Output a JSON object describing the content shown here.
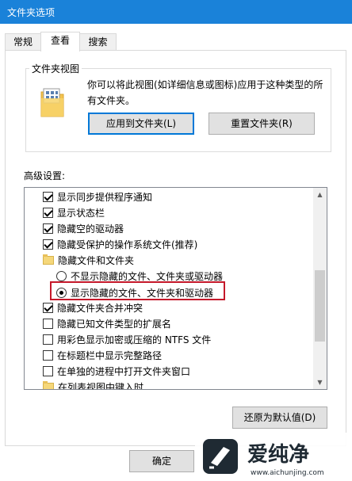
{
  "window": {
    "title": "文件夹选项"
  },
  "tabs": [
    {
      "label": "常规"
    },
    {
      "label": "查看"
    },
    {
      "label": "搜索"
    }
  ],
  "folder_views": {
    "legend": "文件夹视图",
    "description": "你可以将此视图(如详细信息或图标)应用于这种类型的所有文件夹。",
    "apply_label": "应用到文件夹(L)",
    "reset_label": "重置文件夹(R)"
  },
  "advanced": {
    "label": "高级设置:",
    "items": [
      {
        "type": "checkbox",
        "checked": true,
        "label": "显示同步提供程序通知"
      },
      {
        "type": "checkbox",
        "checked": true,
        "label": "显示状态栏"
      },
      {
        "type": "checkbox",
        "checked": true,
        "label": "隐藏空的驱动器"
      },
      {
        "type": "checkbox",
        "checked": true,
        "label": "隐藏受保护的操作系统文件(推荐)"
      },
      {
        "type": "folder",
        "label": "隐藏文件和文件夹"
      },
      {
        "type": "radio",
        "checked": false,
        "label": "不显示隐藏的文件、文件夹或驱动器"
      },
      {
        "type": "radio",
        "checked": true,
        "label": "显示隐藏的文件、文件夹和驱动器"
      },
      {
        "type": "checkbox",
        "checked": true,
        "label": "隐藏文件夹合并冲突"
      },
      {
        "type": "checkbox",
        "checked": false,
        "label": "隐藏已知文件类型的扩展名"
      },
      {
        "type": "checkbox",
        "checked": false,
        "label": "用彩色显示加密或压缩的 NTFS 文件"
      },
      {
        "type": "checkbox",
        "checked": false,
        "label": "在标题栏中显示完整路径"
      },
      {
        "type": "checkbox",
        "checked": false,
        "label": "在单独的进程中打开文件夹窗口"
      },
      {
        "type": "folder",
        "label": "在列表视图中键入时"
      }
    ],
    "restore_label": "还原为默认值(D)"
  },
  "footer": {
    "ok_label": "确定"
  },
  "watermark": {
    "brand": "爱纯净",
    "url": "www.aichunjing.com"
  },
  "colors": {
    "titlebar": "#1a82d9",
    "highlight": "#c5182a",
    "focus": "#0078d7"
  }
}
